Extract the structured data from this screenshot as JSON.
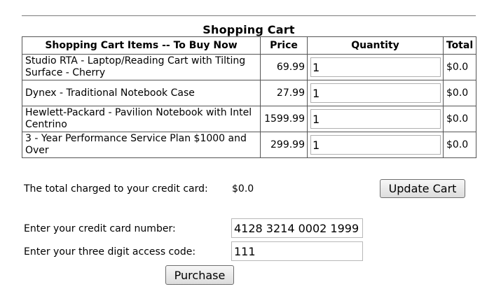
{
  "cart": {
    "title": "Shopping Cart",
    "headers": {
      "items": "Shopping Cart Items -- To Buy Now",
      "price": "Price",
      "quantity": "Quantity",
      "total": "Total"
    },
    "rows": [
      {
        "name": "Studio RTA - Laptop/Reading Cart with Tilting Surface - Cherry",
        "price": "69.99",
        "quantity": "1",
        "total": "$0.0"
      },
      {
        "name": "Dynex - Traditional Notebook Case",
        "price": "27.99",
        "quantity": "1",
        "total": "$0.0"
      },
      {
        "name": "Hewlett-Packard - Pavilion Notebook with Intel Centrino",
        "price": "1599.99",
        "quantity": "1",
        "total": "$0.0"
      },
      {
        "name": "3 - Year Performance Service Plan $1000 and Over",
        "price": "299.99",
        "quantity": "1",
        "total": "$0.0"
      }
    ]
  },
  "summary": {
    "total_label": "The total charged to your credit card:",
    "total_value": "$0.0",
    "update_button": "Update Cart"
  },
  "payment": {
    "card_label": "Enter your credit card number:",
    "card_value": "4128 3214 0002 1999",
    "code_label": "Enter your three digit access code:",
    "code_value": "111",
    "purchase_button": "Purchase"
  }
}
